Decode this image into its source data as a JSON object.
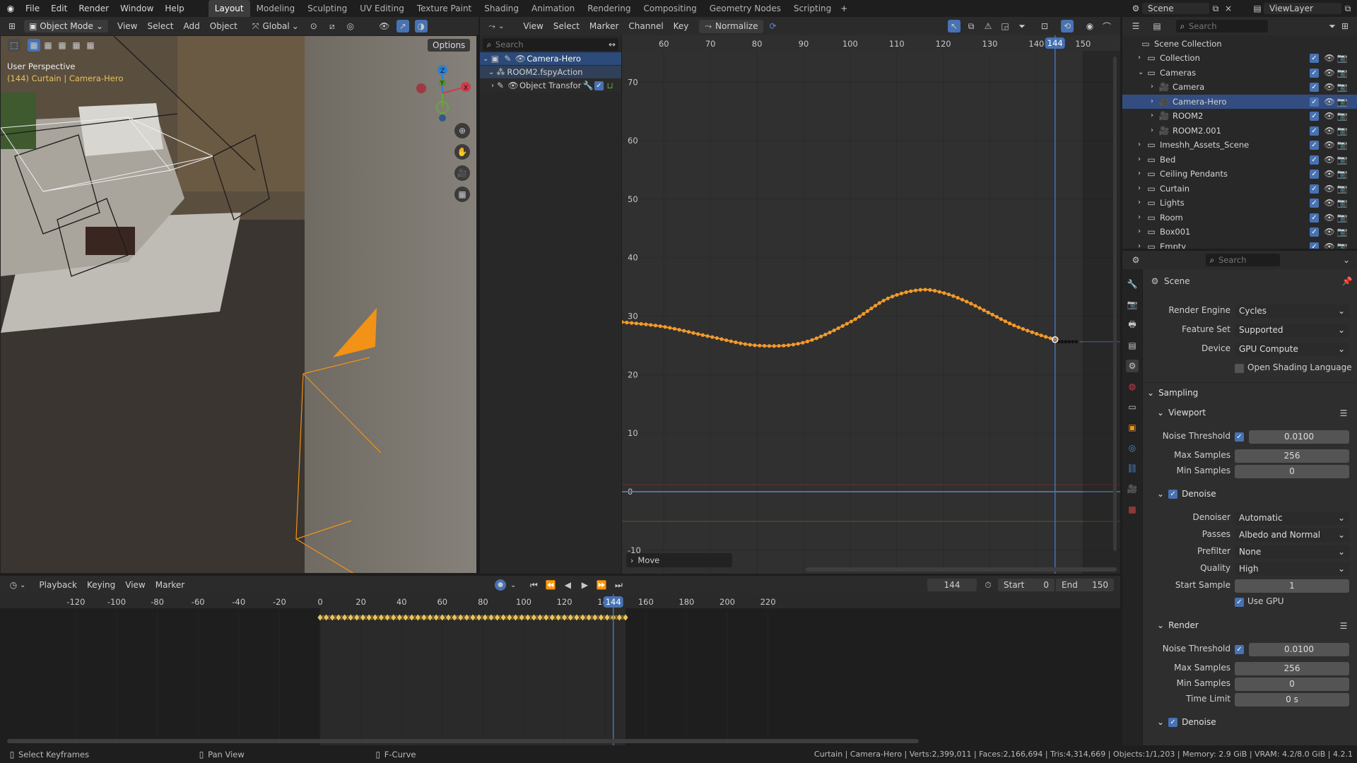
{
  "topbar": {
    "menus": [
      "File",
      "Edit",
      "Render",
      "Window",
      "Help"
    ],
    "workspaces": [
      "Layout",
      "Modeling",
      "Sculpting",
      "UV Editing",
      "Texture Paint",
      "Shading",
      "Animation",
      "Rendering",
      "Compositing",
      "Geometry Nodes",
      "Scripting"
    ],
    "active_workspace": "Layout",
    "scene": "Scene",
    "view_layer": "ViewLayer"
  },
  "viewport": {
    "mode": "Object Mode",
    "menus": [
      "View",
      "Select",
      "Add",
      "Object"
    ],
    "orientation": "Global",
    "options_label": "Options",
    "perspective_label": "User Perspective",
    "object_label": "(144) Curtain | Camera-Hero",
    "gizmo_axes": [
      "Z",
      "Y",
      "X"
    ]
  },
  "graph_editor": {
    "menus": [
      "View",
      "Select",
      "Marker",
      "Channel",
      "Key"
    ],
    "normalize_label": "Normalize",
    "search_placeholder": "Search",
    "channels": [
      "Camera-Hero",
      "ROOM2.fspyAction",
      "Object Transfor"
    ],
    "x_ticks": [
      "60",
      "70",
      "80",
      "90",
      "100",
      "110",
      "120",
      "130",
      "140",
      "150"
    ],
    "y_ticks": [
      "70",
      "60",
      "50",
      "40",
      "30",
      "20",
      "10",
      "0",
      "-10"
    ],
    "current_frame": "144",
    "operator_panel": "Move"
  },
  "chart_data": {
    "type": "line",
    "series": [
      {
        "x": [
          51,
          60,
          70,
          80,
          90,
          100,
          108,
          115,
          120,
          125,
          130,
          135,
          140,
          144
        ],
        "y": [
          29,
          28.2,
          26.5,
          25,
          25.5,
          29,
          33,
          34.5,
          34,
          32.5,
          30.5,
          28.5,
          27,
          26
        ]
      }
    ],
    "xlim": [
      51,
      158
    ],
    "ylim": [
      -14,
      78
    ]
  },
  "timeline": {
    "menus": [
      "Playback",
      "Keying",
      "View",
      "Marker"
    ],
    "ticks": [
      "-120",
      "-100",
      "-80",
      "-60",
      "-40",
      "-20",
      "0",
      "20",
      "40",
      "60",
      "80",
      "100",
      "120",
      "140",
      "160",
      "180",
      "200",
      "220"
    ],
    "current_frame": "144",
    "start_label": "Start",
    "start": "0",
    "end_label": "End",
    "end": "150"
  },
  "outliner": {
    "search_placeholder": "Search",
    "root": "Scene Collection",
    "rows": [
      {
        "label": "Collection",
        "indent": 1
      },
      {
        "label": "Cameras",
        "indent": 1
      },
      {
        "label": "Camera",
        "indent": 2
      },
      {
        "label": "Camera-Hero",
        "indent": 2
      },
      {
        "label": "ROOM2",
        "indent": 2
      },
      {
        "label": "ROOM2.001",
        "indent": 2
      },
      {
        "label": "Imeshh_Assets_Scene",
        "indent": 1
      },
      {
        "label": "Bed",
        "indent": 1
      },
      {
        "label": "Ceiling Pendants",
        "indent": 1
      },
      {
        "label": "Curtain",
        "indent": 1
      },
      {
        "label": "Lights",
        "indent": 1
      },
      {
        "label": "Room",
        "indent": 1
      },
      {
        "label": "Box001",
        "indent": 1
      },
      {
        "label": "Empty",
        "indent": 1
      }
    ]
  },
  "properties": {
    "search_placeholder": "Search",
    "title": "Scene",
    "render_engine_label": "Render Engine",
    "render_engine": "Cycles",
    "feature_set_label": "Feature Set",
    "feature_set": "Supported",
    "device_label": "Device",
    "device": "GPU Compute",
    "osl_label": "Open Shading Language",
    "sampling": "Sampling",
    "viewport": "Viewport",
    "noise_threshold_label": "Noise Threshold",
    "vp_noise": "0.0100",
    "max_samples_label": "Max Samples",
    "vp_max": "256",
    "min_samples_label": "Min Samples",
    "vp_min": "0",
    "denoise_label": "Denoise",
    "denoiser_label": "Denoiser",
    "denoiser": "Automatic",
    "passes_label": "Passes",
    "passes": "Albedo and Normal",
    "prefilter_label": "Prefilter",
    "prefilter": "None",
    "quality_label": "Quality",
    "quality": "High",
    "start_sample_label": "Start Sample",
    "start_sample": "1",
    "use_gpu_label": "Use GPU",
    "render": "Render",
    "r_noise": "0.0100",
    "r_max": "256",
    "r_min": "0",
    "time_limit_label": "Time Limit",
    "time_limit": "0 s",
    "denoise2_label": "Denoise"
  },
  "status_bar": {
    "left": [
      "Select Keyframes",
      "Pan View",
      "F-Curve"
    ],
    "right": "Curtain | Camera-Hero | Verts:2,399,011 | Faces:2,166,694 | Tris:4,314,669 | Objects:1/1,203 | Memory: 2.9 GiB | VRAM: 4.2/8.0 GiB | 4.2.1"
  },
  "colors": {
    "accent": "#4772b3",
    "curve": "#f0921e",
    "selection": "#334d80",
    "playhead": "#4772b3"
  }
}
